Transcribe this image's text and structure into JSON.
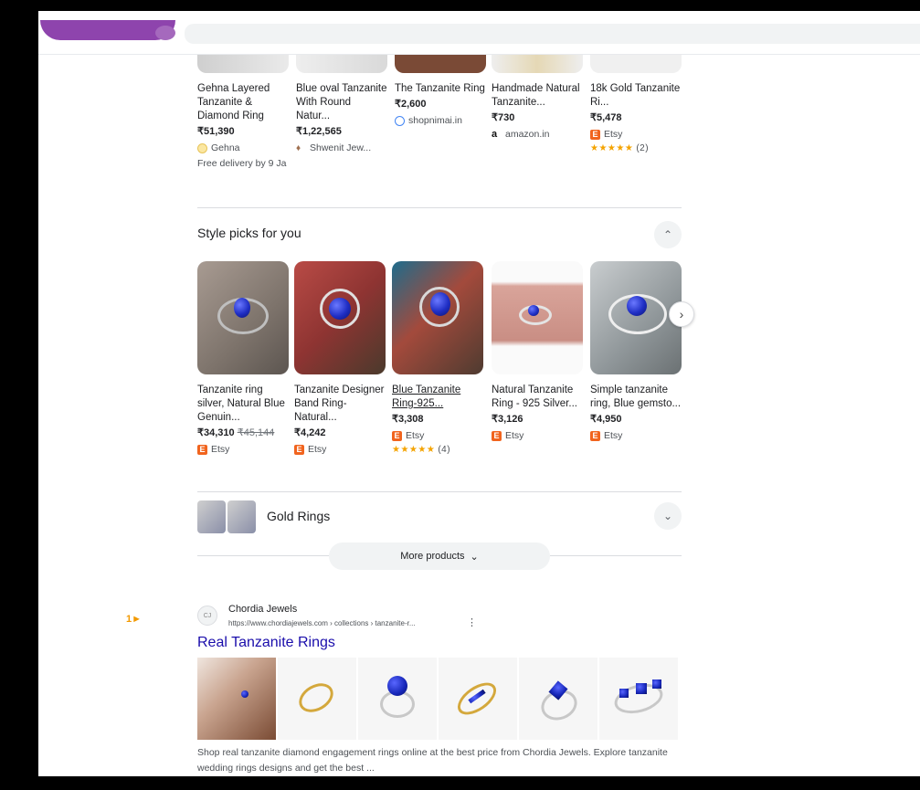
{
  "top_products": [
    {
      "name": "Gehna Layered Tanzanite & Diamond Ring",
      "price": "₹51,390",
      "store": "Gehna",
      "extra": "Free delivery by 9 Ja"
    },
    {
      "name": "Blue oval Tanzanite With Round Natur...",
      "price": "₹1,22,565",
      "store": "Shwenit Jew..."
    },
    {
      "name": "The Tanzanite Ring",
      "price": "₹2,600",
      "store": "shopnimai.in"
    },
    {
      "name": "Handmade Natural Tanzanite...",
      "price": "₹730",
      "store": "amazon.in"
    },
    {
      "name": "18k Gold Tanzanite Ri...",
      "price": "₹5,478",
      "store": "Etsy",
      "rating_stars": "★★★★★",
      "rating_count": "(2)"
    }
  ],
  "style_picks": {
    "title": "Style picks for you",
    "collapse_icon": "chevron-up-icon",
    "next_icon": "chevron-right-icon",
    "items": [
      {
        "name": "Tanzanite ring silver, Natural Blue Genuin...",
        "price": "₹34,310",
        "old_price": "₹45,144",
        "store": "Etsy"
      },
      {
        "name": "Tanzanite Designer Band Ring-Natural...",
        "price": "₹4,242",
        "store": "Etsy"
      },
      {
        "name": "Blue Tanzanite Ring-925...",
        "price": "₹3,308",
        "store": "Etsy",
        "rating_stars": "★★★★★",
        "rating_count": "(4)"
      },
      {
        "name": "Natural Tanzanite Ring - 925 Silver...",
        "price": "₹3,126",
        "store": "Etsy"
      },
      {
        "name": "Simple tanzanite ring, Blue gemsto...",
        "price": "₹4,950",
        "store": "Etsy"
      }
    ]
  },
  "gold_rings": {
    "label": "Gold Rings",
    "expand_icon": "chevron-down-icon"
  },
  "more_products": {
    "label": "More products",
    "icon": "chevron-down-icon"
  },
  "result": {
    "marker": "1",
    "site_name": "Chordia Jewels",
    "url": "https://www.chordiajewels.com › collections › tanzanite-r...",
    "title": "Real Tanzanite Rings",
    "snippet": "Shop real tanzanite diamond engagement rings online at the best price from Chordia Jewels. Explore tanzanite wedding rings designs and get the best ..."
  },
  "colors": {
    "link": "#1a0dab",
    "etsy": "#f1641e",
    "star": "#f4a300",
    "marker": "#f29900"
  }
}
